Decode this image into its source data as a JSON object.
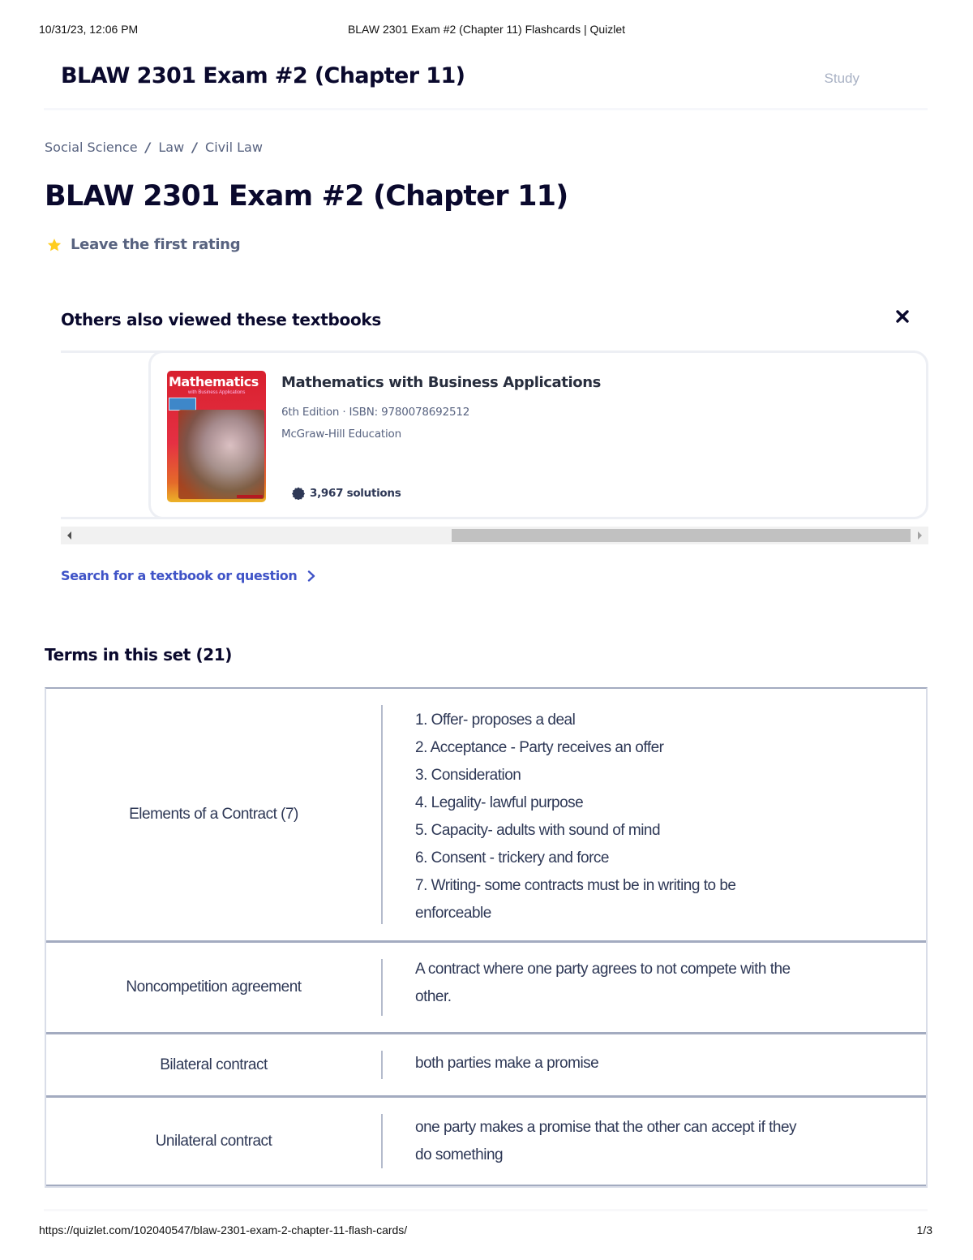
{
  "print_header": {
    "datetime": "10/31/23, 12:06 PM",
    "document_title": "BLAW 2301 Exam #2 (Chapter 11) Flashcards | Quizlet"
  },
  "topbar": {
    "title": "BLAW 2301 Exam #2 (Chapter 11)",
    "study_label": "Study"
  },
  "breadcrumb": {
    "items": [
      "Social Science",
      "Law",
      "Civil Law"
    ],
    "separator": "/"
  },
  "page": {
    "title": "BLAW 2301 Exam #2 (Chapter 11)",
    "rating_label": "Leave the first rating"
  },
  "textbooks": {
    "heading": "Others also viewed these textbooks",
    "close_icon": "close-icon",
    "cards": [
      {
        "cover_title": "Mathematics",
        "cover_subtitle": "with Business Applications",
        "title": "Mathematics with Business Applications",
        "meta": "6th Edition · ISBN: 9780078692512",
        "publisher": "McGraw-Hill Education",
        "solutions": "3,967 solutions"
      }
    ],
    "scroll_position": 0.45
  },
  "search_link": {
    "label": "Search for a textbook or question",
    "icon": "chevron-right-icon"
  },
  "terms_section": {
    "heading": "Terms in this set (21)",
    "rows": [
      {
        "term": "Elements of a Contract (7)",
        "definition": "1. Offer- proposes a deal\n2. Acceptance - Party receives an offer\n3. Consideration\n4. Legality- lawful purpose\n5. Capacity- adults with sound of mind\n6. Consent - trickery and force\n7. Writing- some contracts must be in writing to be\nenforceable"
      },
      {
        "term": "Noncompetition agreement",
        "definition": "A contract where one party agrees to not compete with the\nother."
      },
      {
        "term": "Bilateral contract",
        "definition": "both parties make a promise"
      },
      {
        "term": "Unilateral contract",
        "definition": "one party makes a promise that the other can accept if they\ndo something"
      }
    ]
  },
  "print_footer": {
    "url": "https://quizlet.com/102040547/blaw-2301-exam-2-chapter-11-flash-cards/",
    "page": "1/3"
  },
  "colors": {
    "heading": "#0a092d",
    "muted": "#586380",
    "link": "#3f53c7",
    "star": "#ffcd1f",
    "card_border": "#edeff4",
    "table_border": "#a3abc0"
  }
}
